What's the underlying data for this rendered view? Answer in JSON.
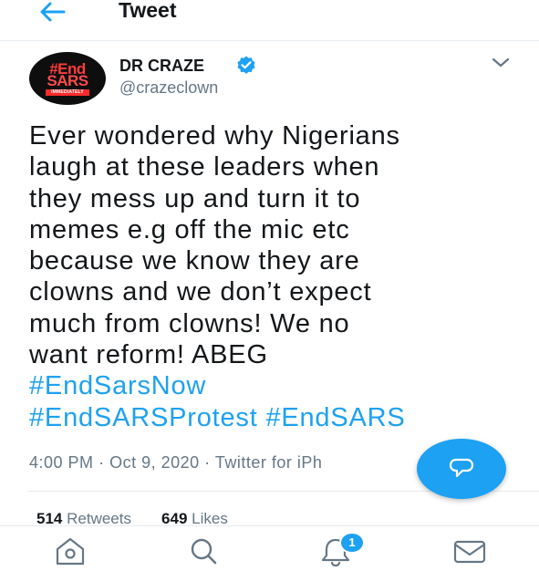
{
  "header": {
    "back_icon": "arrow-left-icon",
    "title": "Tweet"
  },
  "author": {
    "avatar": {
      "hashtag": "#End",
      "word": "SARS",
      "banner": "IMMEDIATELY"
    },
    "display_name": "DR CRAZE",
    "verified_icon": "verified-badge-icon",
    "handle": "@crazeclown",
    "more_icon": "chevron-down-icon"
  },
  "tweet": {
    "lines": [
      "Ever wondered why  Nigerians",
      "laugh at these leaders when",
      "they mess up and turn it to",
      "memes e.g off the mic etc",
      "because we know they are",
      "clowns and we don’t expect",
      "much from clowns! We no",
      "want reform! ABEG"
    ],
    "hashtags": [
      "#EndSarsNow",
      "#EndSARSProtest",
      "#EndSARS"
    ],
    "time": "4:00 PM",
    "date": "Oct 9, 2020",
    "source": "Twitter for iPh",
    "separator": "·"
  },
  "stats": {
    "retweets_count": "514",
    "retweets_label": "Retweets",
    "likes_count": "649",
    "likes_label": "Likes"
  },
  "fab": {
    "icon": "compose-reply-icon"
  },
  "bottom_nav": {
    "items": [
      {
        "icon": "home-icon"
      },
      {
        "icon": "search-icon"
      },
      {
        "icon": "notifications-bell-icon",
        "badge": "1"
      },
      {
        "icon": "messages-envelope-icon"
      }
    ]
  },
  "colors": {
    "accent": "#1da1f2",
    "text": "#14171a",
    "muted": "#657786",
    "divider": "#e6ecf0"
  }
}
